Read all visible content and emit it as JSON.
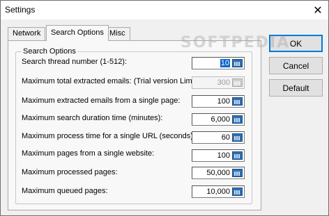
{
  "window": {
    "title": "Settings",
    "close_glyph": "✕"
  },
  "tabs": [
    {
      "label": "Network",
      "active": false
    },
    {
      "label": "Search Options",
      "active": true
    },
    {
      "label": "Misc",
      "active": false
    }
  ],
  "group": {
    "label": "Search Options"
  },
  "rows": [
    {
      "label": "Search thread number (1-512):",
      "value": "10",
      "enabled": true,
      "selected": true
    },
    {
      "label": "Maximum total extracted emails: (Trial version Limit)",
      "value": "300",
      "enabled": false
    },
    {
      "label": "Maximum extracted emails from a single page:",
      "value": "100",
      "enabled": true
    },
    {
      "label": "Maximum search duration time (minutes):",
      "value": "6,000",
      "enabled": true
    },
    {
      "label": "Maximum process time for a single URL (seconds):",
      "value": "60",
      "enabled": true
    },
    {
      "label": "Maximum pages from a single website:",
      "value": "100",
      "enabled": true
    },
    {
      "label": "Maximum processed pages:",
      "value": "50,000",
      "enabled": true
    },
    {
      "label": "Maximum queued pages:",
      "value": "10,000",
      "enabled": true
    }
  ],
  "buttons": {
    "ok": "OK",
    "cancel": "Cancel",
    "default": "Default"
  },
  "watermark": "SOFTPEDIA",
  "icons": {
    "spin": "calculator-icon",
    "close": "close-icon"
  },
  "colors": {
    "accent": "#0078d7",
    "selection": "#0a64d0",
    "spin_icon": "#2f6fb1"
  }
}
